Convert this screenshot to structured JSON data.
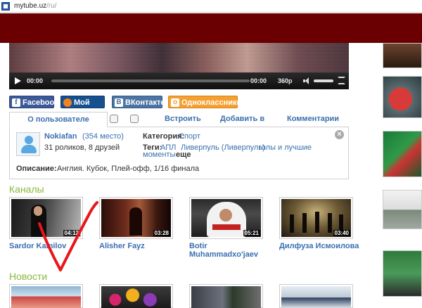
{
  "browser": {
    "domain": "mytube.uz",
    "path": "/ru/"
  },
  "player": {
    "current_time": "00:00",
    "total_time": "00:00",
    "quality": "360p"
  },
  "share": {
    "facebook": "Facebook",
    "facebook_icon": "f",
    "moimir": "Мой мир",
    "vk": "ВКонтакте",
    "vk_icon": "В",
    "ok": "Одноклассники",
    "ok_icon": "о"
  },
  "tabs": {
    "about": "О пользователе",
    "embed": "Встроить",
    "add_to": "Добавить в",
    "comments": "Комментарии"
  },
  "user": {
    "name": "Nokiafan",
    "rank": "(354 место)",
    "stats": "31 роликов, 8 друзей",
    "category_label": "Категория:",
    "category": "Спорт",
    "tags_label": "Теги:",
    "tags": [
      "АПЛ",
      "Ливерпуль (Ливерпуль)",
      "голы и лучшие",
      "моменты"
    ],
    "more": "еще",
    "description_label": "Описание:",
    "description": "Англия. Кубок, Плей-офф, 1/16 финала"
  },
  "close_icon": "×",
  "sections": {
    "channels": "Каналы",
    "news": "Новости"
  },
  "channels": [
    {
      "title": "Sardor Kamilov",
      "duration": "04:12"
    },
    {
      "title": "Alisher Fayz",
      "duration": "03:28"
    },
    {
      "title": "Botir Muhammadxo'jaev",
      "duration": "05:21"
    },
    {
      "title": "Дилфуза Исмоилова",
      "duration": "03:40"
    }
  ],
  "colors": {
    "banner": "#6a0001",
    "link": "#3a6fb0",
    "section": "#8cb83c",
    "checkmark": "#e8161b"
  }
}
